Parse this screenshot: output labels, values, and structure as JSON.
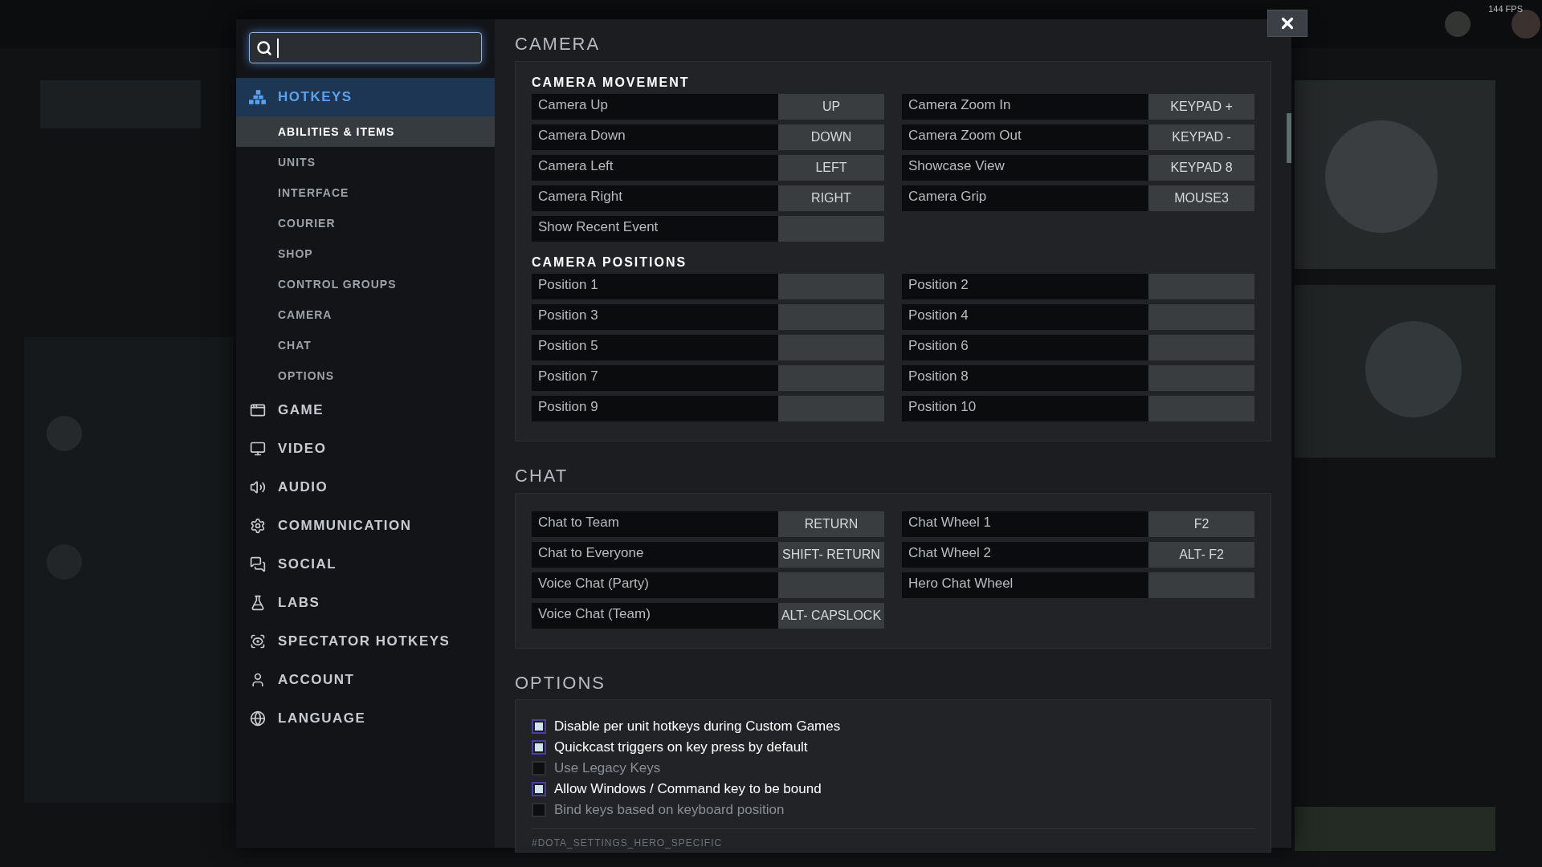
{
  "fps": "144 FPS",
  "nav": [
    {
      "label": "HOTKEYS",
      "selected": true,
      "children": [
        {
          "label": "ABILITIES & ITEMS",
          "selected": true
        },
        {
          "label": "UNITS",
          "selected": false
        },
        {
          "label": "INTERFACE",
          "selected": false
        },
        {
          "label": "COURIER",
          "selected": false
        },
        {
          "label": "SHOP",
          "selected": false
        },
        {
          "label": "CONTROL GROUPS",
          "selected": false
        },
        {
          "label": "CAMERA",
          "selected": false
        },
        {
          "label": "CHAT",
          "selected": false
        },
        {
          "label": "OPTIONS",
          "selected": false
        }
      ]
    },
    {
      "label": "GAME",
      "selected": false
    },
    {
      "label": "VIDEO",
      "selected": false
    },
    {
      "label": "AUDIO",
      "selected": false
    },
    {
      "label": "COMMUNICATION",
      "selected": false
    },
    {
      "label": "SOCIAL",
      "selected": false
    },
    {
      "label": "LABS",
      "selected": false
    },
    {
      "label": "SPECTATOR HOTKEYS",
      "selected": false
    },
    {
      "label": "ACCOUNT",
      "selected": false
    },
    {
      "label": "LANGUAGE",
      "selected": false
    }
  ],
  "sections": [
    {
      "title": "CAMERA",
      "groups": [
        {
          "heading": "CAMERA MOVEMENT",
          "bindings": [
            {
              "label": "Camera Up",
              "key": "UP"
            },
            {
              "label": "Camera Zoom In",
              "key": "KEYPAD +"
            },
            {
              "label": "Camera Down",
              "key": "DOWN"
            },
            {
              "label": "Camera Zoom Out",
              "key": "KEYPAD -"
            },
            {
              "label": "Camera Left",
              "key": "LEFT"
            },
            {
              "label": "Showcase View",
              "key": "KEYPAD 8"
            },
            {
              "label": "Camera Right",
              "key": "RIGHT"
            },
            {
              "label": "Camera Grip",
              "key": "MOUSE3"
            },
            {
              "label": "Show Recent Event"
            }
          ]
        },
        {
          "heading": "CAMERA POSITIONS",
          "bindings": [
            {
              "label": "Position 1"
            },
            {
              "label": "Position 2"
            },
            {
              "label": "Position 3"
            },
            {
              "label": "Position 4"
            },
            {
              "label": "Position 5"
            },
            {
              "label": "Position 6"
            },
            {
              "label": "Position 7"
            },
            {
              "label": "Position 8"
            },
            {
              "label": "Position 9"
            },
            {
              "label": "Position 10"
            }
          ]
        }
      ]
    },
    {
      "title": "CHAT",
      "groups": [
        {
          "bindings": [
            {
              "label": "Chat to Team",
              "key": "RETURN"
            },
            {
              "label": "Chat Wheel 1",
              "key": "F2"
            },
            {
              "label": "Chat to Everyone",
              "key": "SHIFT- RETURN"
            },
            {
              "label": "Chat Wheel 2",
              "key": "ALT- F2"
            },
            {
              "label": "Voice Chat (Party)"
            },
            {
              "label": "Hero Chat Wheel"
            },
            {
              "label": "Voice Chat (Team)",
              "key": "ALT- CAPSLOCK"
            }
          ]
        }
      ]
    }
  ],
  "options": {
    "title": "OPTIONS",
    "checkboxes": [
      {
        "label": "Disable per unit hotkeys during Custom Games",
        "checked": true
      },
      {
        "label": "Quickcast triggers on key press by default",
        "checked": true
      },
      {
        "label": "Use Legacy Keys",
        "checked": false
      },
      {
        "label": "Allow Windows / Command key to be bound",
        "checked": true
      },
      {
        "label": "Bind keys based on keyboard position",
        "checked": false
      }
    ],
    "next_heading": "#DOTA_SETTINGS_HERO_SPECIFIC"
  }
}
